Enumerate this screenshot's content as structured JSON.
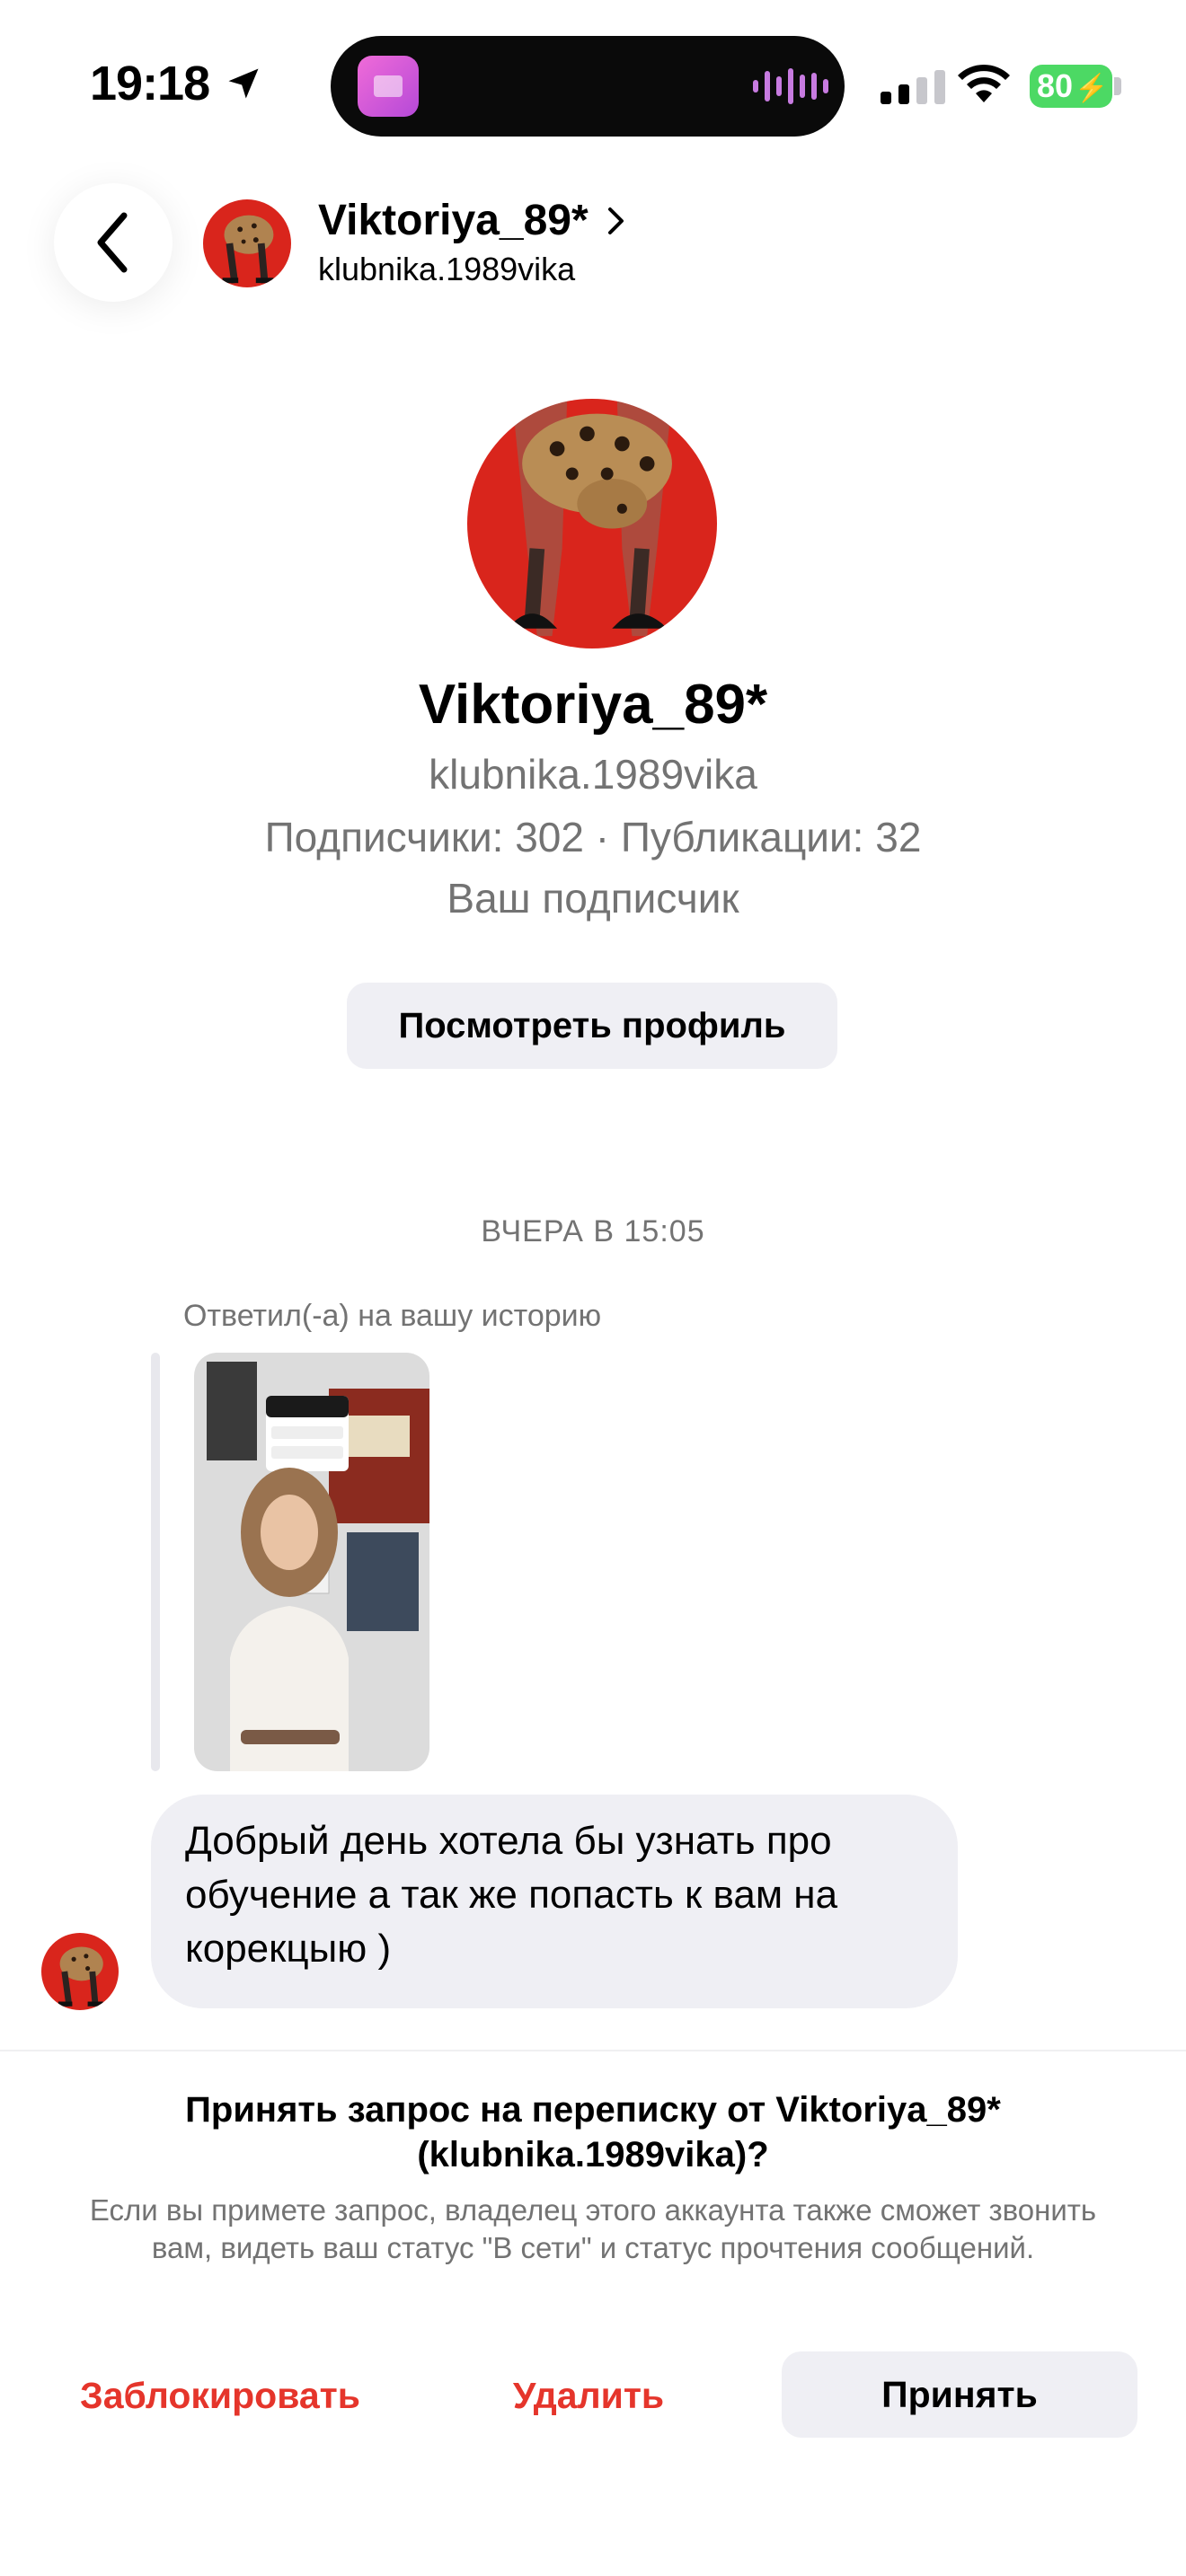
{
  "status_bar": {
    "time": "19:18",
    "battery": "80",
    "icons": [
      "location-arrow-icon",
      "signal-icon",
      "wifi-icon",
      "battery-charging-icon"
    ]
  },
  "header": {
    "name": "Viktoriya_89*",
    "username": "klubnika.1989vika",
    "icons": [
      "back-chevron-icon",
      "chevron-right-icon"
    ]
  },
  "profile": {
    "name": "Viktoriya_89*",
    "username": "klubnika.1989vika",
    "stats": "Подписчики: 302 · Публикации: 32",
    "relation": "Ваш подписчик",
    "view_profile_label": "Посмотреть профиль"
  },
  "thread": {
    "timestamp": "ВЧЕРА В 15:05",
    "story_reply_label": "Ответил(-а) на вашу историю",
    "message": "Добрый день хотела бы узнать про обучение а так же попасть к вам на корекцыю )"
  },
  "request": {
    "title": "Принять запрос на переписку от Viktoriya_89* (klubnika.1989vika)?",
    "description": "Если вы примете запрос, владелец этого аккаунта также сможет звонить вам, видеть ваш статус \"В сети\" и статус прочтения сообщений.",
    "block_label": "Заблокировать",
    "delete_label": "Удалить",
    "accept_label": "Принять"
  },
  "colors": {
    "accent_red": "#e5352b",
    "secondary_text": "#737373",
    "bubble_bg": "#efeff4",
    "battery_green": "#4cd964"
  }
}
